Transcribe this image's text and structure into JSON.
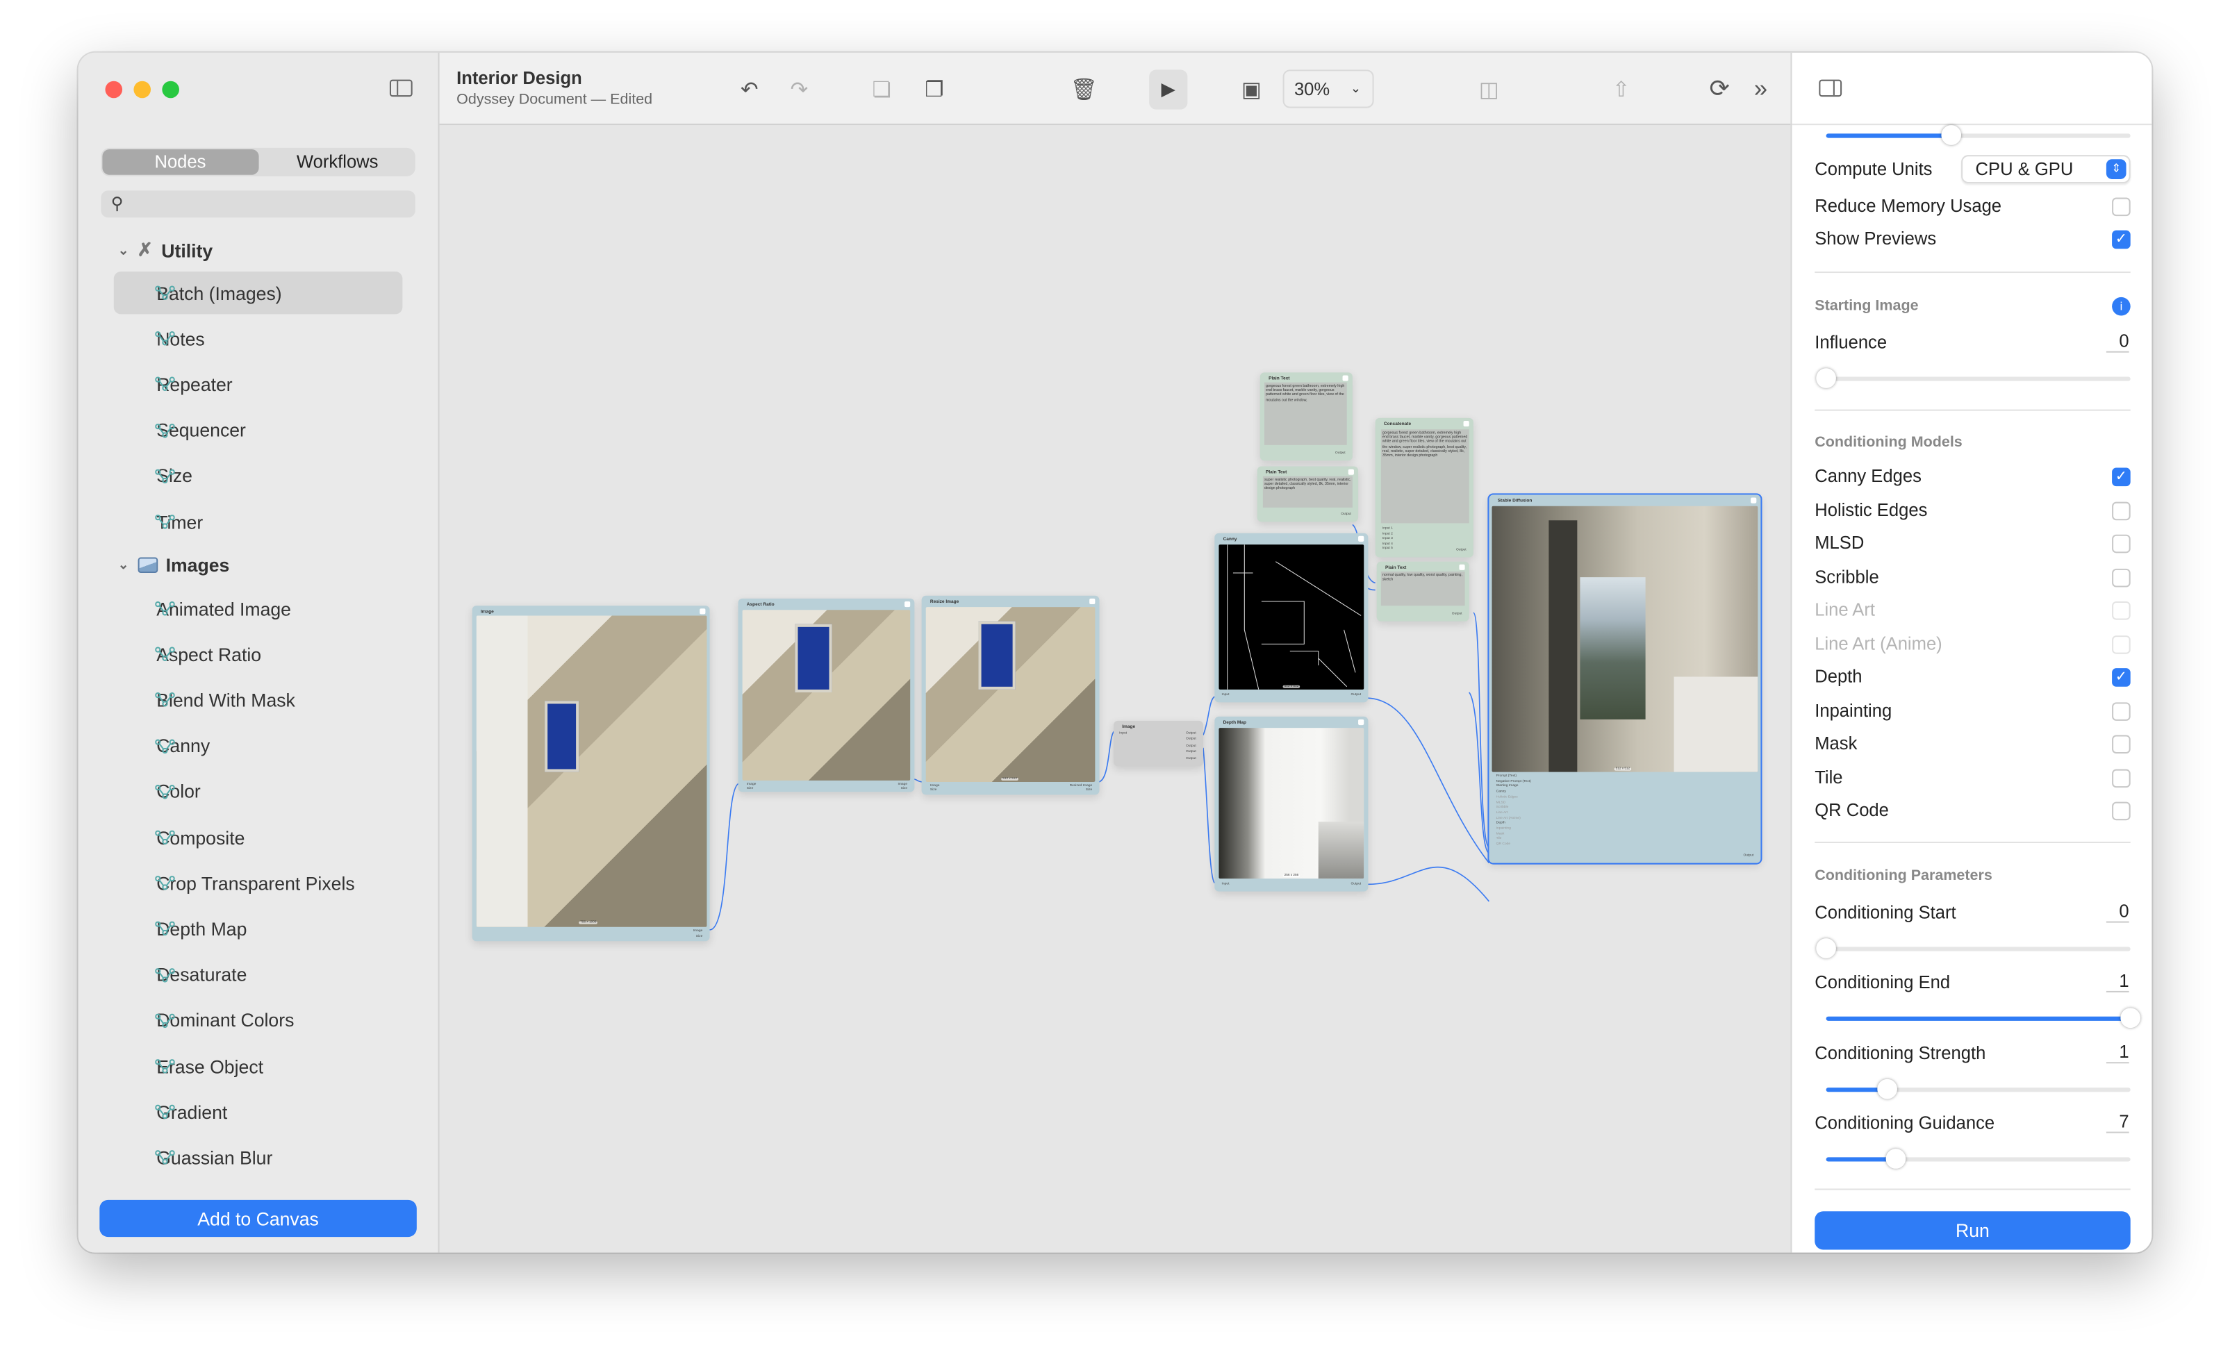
{
  "window": {
    "title": "Interior Design",
    "subtitle": "Odyssey Document — Edited"
  },
  "sidebar": {
    "tabs": [
      {
        "label": "Nodes",
        "selected": true
      },
      {
        "label": "Workflows",
        "selected": false
      }
    ],
    "search": {
      "placeholder": "",
      "value": ""
    },
    "groups": [
      {
        "label": "Utility",
        "icon": "tools-icon",
        "items": [
          "Batch (Images)",
          "Notes",
          "Repeater",
          "Sequencer",
          "Size",
          "Timer"
        ]
      },
      {
        "label": "Images",
        "icon": "photo-icon",
        "items": [
          "Animated Image",
          "Aspect Ratio",
          "Blend With Mask",
          "Canny",
          "Color",
          "Composite",
          "Crop Transparent Pixels",
          "Depth Map",
          "Desaturate",
          "Dominant Colors",
          "Erase Object",
          "Gradient",
          "Guassian Blur"
        ]
      }
    ],
    "selected_item": "Batch (Images)",
    "add_button": "Add to Canvas"
  },
  "toolbar": {
    "icons": [
      "undo-icon",
      "redo-icon",
      "copy-icon",
      "paste-icon",
      "trash-icon",
      "play-icon",
      "fit-icon",
      "center-icon",
      "share-icon",
      "refresh-icon",
      "chevrons-right-icon"
    ],
    "zoom": "30%"
  },
  "canvas": {
    "nodes": {
      "image": {
        "title": "Image",
        "size_label": "756 x 1008",
        "outputs": [
          "Image",
          "Size"
        ]
      },
      "aspect": {
        "title": "Aspect Ratio",
        "inputs": [
          "Image",
          "Size"
        ],
        "outputs": [
          "Image",
          "Size"
        ]
      },
      "resize": {
        "title": "Resize Image",
        "size_label": "512 x 512",
        "inputs": [
          "Image",
          "Size"
        ],
        "outputs": [
          "Resized Image",
          "Size"
        ]
      },
      "imgsplit": {
        "title": "Image",
        "inputs": [
          "Input"
        ],
        "outputs": [
          "Output",
          "Output",
          "Output",
          "Output",
          "Output"
        ]
      },
      "canny": {
        "title": "Canny",
        "size_label": "512 x 512",
        "inputs": [
          "Input"
        ],
        "outputs": [
          "Output"
        ]
      },
      "depth": {
        "title": "Depth Map",
        "size_label": "256 x 256",
        "inputs": [
          "Input"
        ],
        "outputs": [
          "Output"
        ]
      },
      "text1": {
        "title": "Plain Text",
        "text": "gorgeous forest green bathroom, extremely high end brass faucet, marble vanity, gorgeous patterned white and green floor tiles, view of the moutains out the window,",
        "outputs": [
          "Output"
        ]
      },
      "text2": {
        "title": "Plain Text",
        "text": "super realistic photograph, best quality, real, realistic, super detailed, classically styled, 8k, 35mm, interior design photograph",
        "outputs": [
          "Output"
        ]
      },
      "concat": {
        "title": "Concatenate",
        "text": "gorgeous forest green bathroom, extremely high end brass faucet, marble vanity, gorgeous patterned white and green floor tiles, view of the moutains out the window,  super realistic photograph, best quality, real, realistic, super detailed, classically styled, 8k, 35mm, interior design photograph",
        "inputs": [
          "Input 1",
          "Input 2",
          "Input 3",
          "Input 4",
          "Input 5"
        ],
        "outputs": [
          "Output"
        ]
      },
      "text3": {
        "title": "Plain Text",
        "text": "normal quality, low quality, worst quality, painting, sketch",
        "outputs": [
          "Output"
        ]
      },
      "sd": {
        "title": "Stable Diffusion",
        "size_label": "512 x 512",
        "inputs": [
          "Prompt (Text)",
          "Negative Prompt (Text)",
          "Starting Image",
          "Canny",
          "Holistic Edges",
          "MLSD",
          "Scribble",
          "Line Art",
          "Line Art (Anime)",
          "Depth",
          "Inpainting",
          "Mask",
          "Tile",
          "QR Code"
        ],
        "outputs": [
          "Output"
        ]
      }
    }
  },
  "inspector": {
    "top_slider": 0.41,
    "compute_units": {
      "label": "Compute Units",
      "value": "CPU & GPU"
    },
    "reduce_memory": {
      "label": "Reduce Memory Usage",
      "checked": false
    },
    "show_previews": {
      "label": "Show Previews",
      "checked": true
    },
    "starting_image": {
      "heading": "Starting Image",
      "influence_label": "Influence",
      "influence_value": "0",
      "influence_level": 0
    },
    "models_heading": "Conditioning Models",
    "models": [
      {
        "label": "Canny Edges",
        "checked": true,
        "enabled": true
      },
      {
        "label": "Holistic Edges",
        "checked": false,
        "enabled": true
      },
      {
        "label": "MLSD",
        "checked": false,
        "enabled": true
      },
      {
        "label": "Scribble",
        "checked": false,
        "enabled": true
      },
      {
        "label": "Line Art",
        "checked": false,
        "enabled": false
      },
      {
        "label": "Line Art (Anime)",
        "checked": false,
        "enabled": false
      },
      {
        "label": "Depth",
        "checked": true,
        "enabled": true
      },
      {
        "label": "Inpainting",
        "checked": false,
        "enabled": true
      },
      {
        "label": "Mask",
        "checked": false,
        "enabled": true
      },
      {
        "label": "Tile",
        "checked": false,
        "enabled": true
      },
      {
        "label": "QR Code",
        "checked": false,
        "enabled": true
      }
    ],
    "params_heading": "Conditioning Parameters",
    "params": [
      {
        "label": "Conditioning Start",
        "value": "0",
        "level": 0
      },
      {
        "label": "Conditioning End",
        "value": "1",
        "level": 1
      },
      {
        "label": "Conditioning Strength",
        "value": "1",
        "level": 0.2
      },
      {
        "label": "Conditioning Guidance",
        "value": "7",
        "level": 0.23
      }
    ],
    "run_button": "Run"
  },
  "colors": {
    "accent": "#2f7cf6",
    "node_image": "#b9d0d8",
    "node_text": "#c6d9cc",
    "wire": "#3b7bf2"
  }
}
